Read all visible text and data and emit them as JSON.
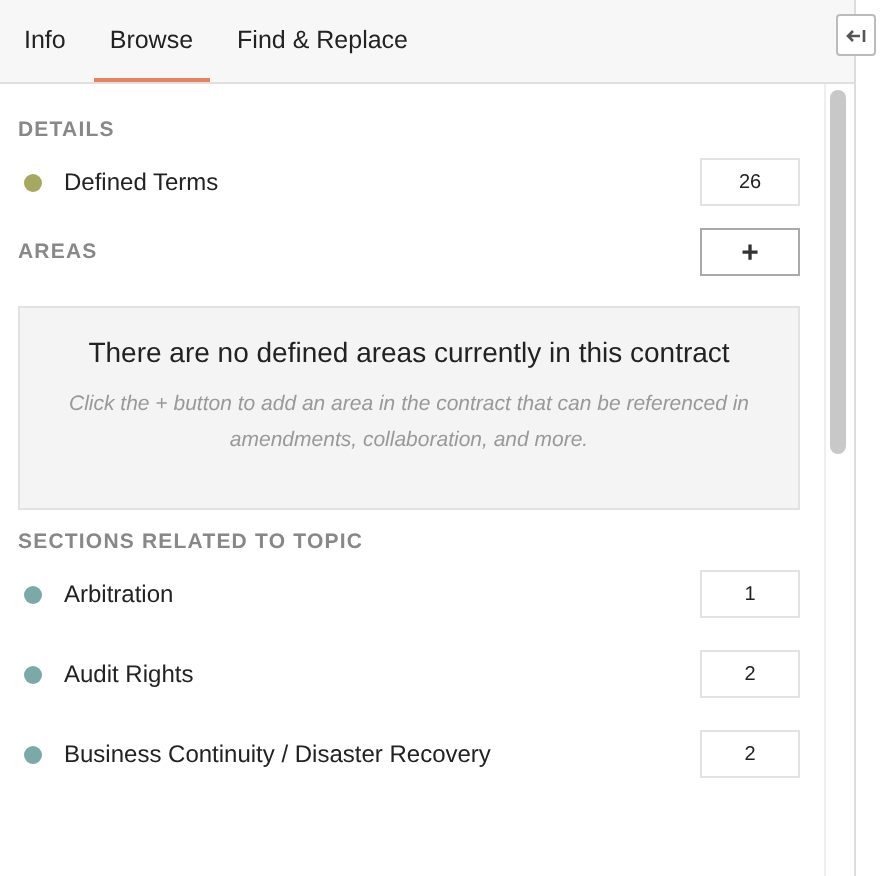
{
  "tabs": [
    {
      "label": "Info",
      "selected": false
    },
    {
      "label": "Browse",
      "selected": true
    },
    {
      "label": "Find & Replace",
      "selected": false
    }
  ],
  "details": {
    "heading": "DETAILS",
    "items": [
      {
        "name": "Defined Terms",
        "count": "26",
        "color": "#a6a860"
      }
    ]
  },
  "areas": {
    "heading": "AREAS",
    "add_button": "+",
    "empty_title": "There are no defined areas currently in this contract",
    "empty_hint": "Click the + button to add an area in the contract that can be referenced in amendments, collaboration, and more."
  },
  "sections": {
    "heading": "SECTIONS RELATED TO TOPIC",
    "items": [
      {
        "name": "Arbitration",
        "count": "1",
        "color": "#7aa9a8"
      },
      {
        "name": "Audit Rights",
        "count": "2",
        "color": "#7aa9a8"
      },
      {
        "name": "Business Continuity / Disaster Recovery",
        "count": "2",
        "color": "#7aa9a8"
      }
    ]
  }
}
